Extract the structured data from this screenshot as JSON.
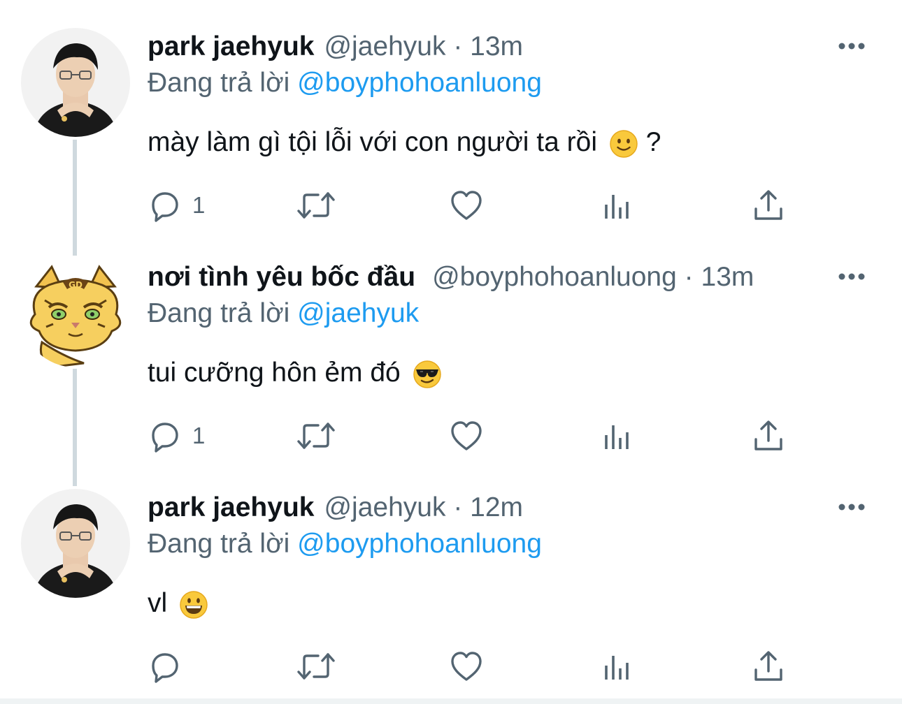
{
  "tweets": [
    {
      "name": "park jaehyuk",
      "handle": "@jaehyuk",
      "separator": "·",
      "time": "13m",
      "replying_prefix": "Đang trả lời",
      "replying_to": "@boyphohoanluong",
      "text": "mày làm gì tội lỗi với con người ta rồi",
      "text_suffix": "?",
      "emoji": "slightly-smiling-face",
      "reply_count": "1",
      "avatar": "person-avatar"
    },
    {
      "name": "nơi tình yêu bốc đầu",
      "handle": "@boyphohoanluong",
      "separator": "·",
      "time": "13m",
      "replying_prefix": "Đang trả lời",
      "replying_to": "@jaehyuk",
      "text": "tui cưỡng hôn ẻm đó",
      "text_suffix": "",
      "emoji": "sunglasses-face",
      "reply_count": "1",
      "avatar": "tiger-cat-avatar"
    },
    {
      "name": "park jaehyuk",
      "handle": "@jaehyuk",
      "separator": "·",
      "time": "12m",
      "replying_prefix": "Đang trả lời",
      "replying_to": "@boyphohoanluong",
      "text": "vl",
      "text_suffix": "",
      "emoji": "grinning-face",
      "reply_count": "",
      "avatar": "person-avatar"
    }
  ],
  "icons": {
    "more": "more-horizontal-icon",
    "reply": "reply-icon",
    "retweet": "retweet-icon",
    "like": "heart-icon",
    "views": "views-chart-icon",
    "share": "share-icon"
  },
  "colors": {
    "text_primary": "#0f1419",
    "text_secondary": "#536471",
    "mention": "#1d9bf0",
    "thread_line": "#cfd9de"
  }
}
